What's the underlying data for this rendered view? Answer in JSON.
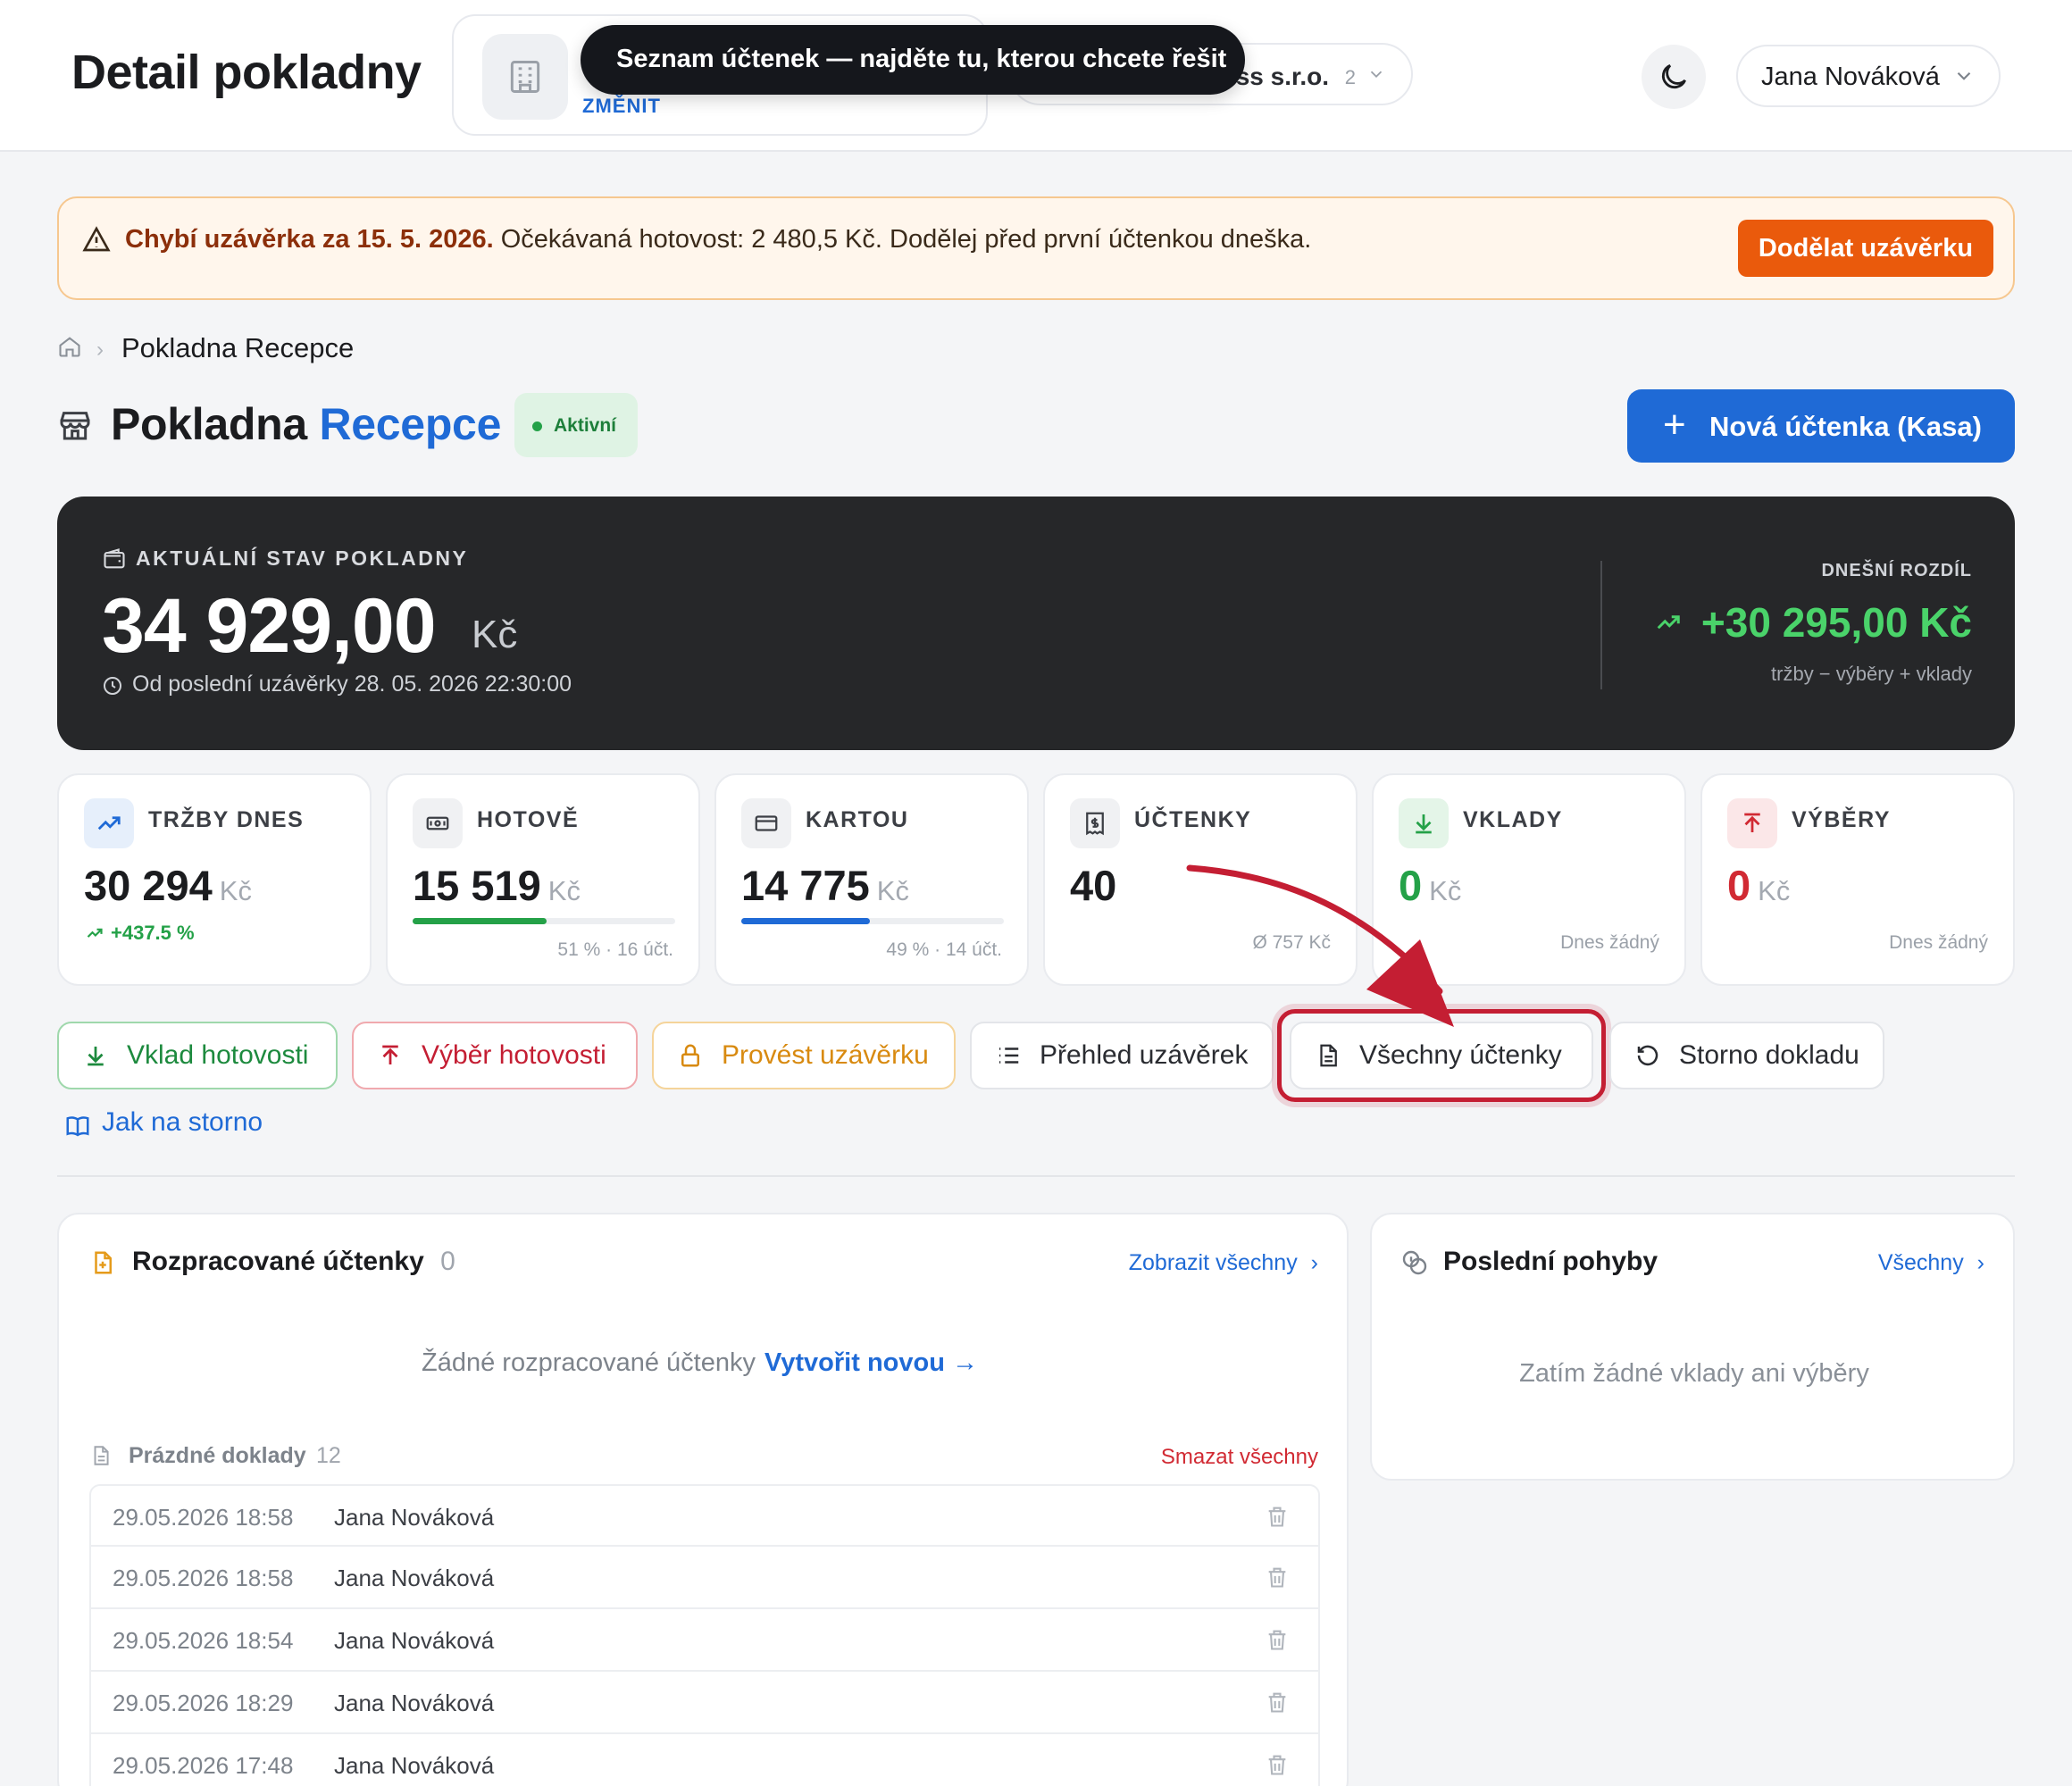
{
  "header": {
    "title": "Detail pokladny",
    "company_change": "ZMĚNIT",
    "company_select_name": "ss s.r.o.",
    "company_select_count": "2",
    "tooltip": "Seznam účtenek — najděte tu, kterou chcete řešit",
    "user_name": "Jana Nováková"
  },
  "alert": {
    "bold": "Chybí uzávěrka za 15. 5. 2026.",
    "text": " Očekávaná hotovost: 2 480,5 Kč. Dodělej před první účtenkou dneška.",
    "button": "Dodělat uzávěrku"
  },
  "breadcrumb": {
    "current": "Pokladna Recepce"
  },
  "title": {
    "prefix": "Pokladna ",
    "accent": "Recepce",
    "status": "Aktivní",
    "new_button": "Nová účtenka (Kasa)"
  },
  "hero": {
    "label": "AKTUÁLNÍ STAV POKLADNY",
    "amount": "34 929,00",
    "currency": "Kč",
    "since": "Od poslední uzávěrky 28. 05. 2026 22:30:00",
    "diff_label": "DNEŠNÍ ROZDÍL",
    "diff_value": "+30 295,00 Kč",
    "diff_sub": "tržby − výběry + vklady"
  },
  "cards": [
    {
      "label": "TRŽBY DNES",
      "value": "30 294",
      "currency": "Kč",
      "trend": "+437.5 %",
      "icon": "trending-up-icon"
    },
    {
      "label": "HOTOVĚ",
      "value": "15 519",
      "currency": "Kč",
      "sub": "51 % · 16 účt.",
      "share": 0.51,
      "bar_color": "#24a148",
      "icon": "cash-icon"
    },
    {
      "label": "KARTOU",
      "value": "14 775",
      "currency": "Kč",
      "sub": "49 % · 14 účt.",
      "share": 0.49,
      "bar_color": "#1f6ad6",
      "icon": "card-icon"
    },
    {
      "label": "ÚČTENKY",
      "value": "40",
      "sub": "Ø 757 Kč",
      "icon": "receipt-icon"
    },
    {
      "label": "VKLADY",
      "value": "0",
      "currency": "Kč",
      "sub": "Dnes žádný",
      "value_color": "#24a148",
      "icon": "download-icon"
    },
    {
      "label": "VÝBĚRY",
      "value": "0",
      "currency": "Kč",
      "sub": "Dnes žádný",
      "value_color": "#d12a33",
      "icon": "upload-icon"
    }
  ],
  "actions": {
    "deposit": "Vklad hotovosti",
    "withdraw": "Výběr hotovosti",
    "closing": "Provést uzávěrku",
    "closings_overview": "Přehled uzávěrek",
    "all_receipts": "Všechny účtenky",
    "storno": "Storno dokladu",
    "storno_guide": "Jak na storno"
  },
  "drafts": {
    "title": "Rozpracované účtenky",
    "count": "0",
    "show_all": "Zobrazit všechny",
    "empty": "Žádné rozpracované účtenky",
    "create": "Vytvořit novou →",
    "empty_docs_title": "Prázdné doklady",
    "empty_docs_count": "12",
    "delete_all": "Smazat všechny",
    "rows": [
      {
        "date": "29.05.2026 18:58",
        "user": "Jana Nováková"
      },
      {
        "date": "29.05.2026 18:58",
        "user": "Jana Nováková"
      },
      {
        "date": "29.05.2026 18:54",
        "user": "Jana Nováková"
      },
      {
        "date": "29.05.2026 18:29",
        "user": "Jana Nováková"
      },
      {
        "date": "29.05.2026 17:48",
        "user": "Jana Nováková"
      }
    ]
  },
  "moves": {
    "title": "Poslední pohyby",
    "all": "Všechny",
    "empty": "Zatím žádné vklady ani výběry"
  },
  "colors": {
    "accent": "#1f6ad6",
    "success": "#24a148",
    "danger": "#d12a33",
    "warning": "#ea5a0c"
  }
}
